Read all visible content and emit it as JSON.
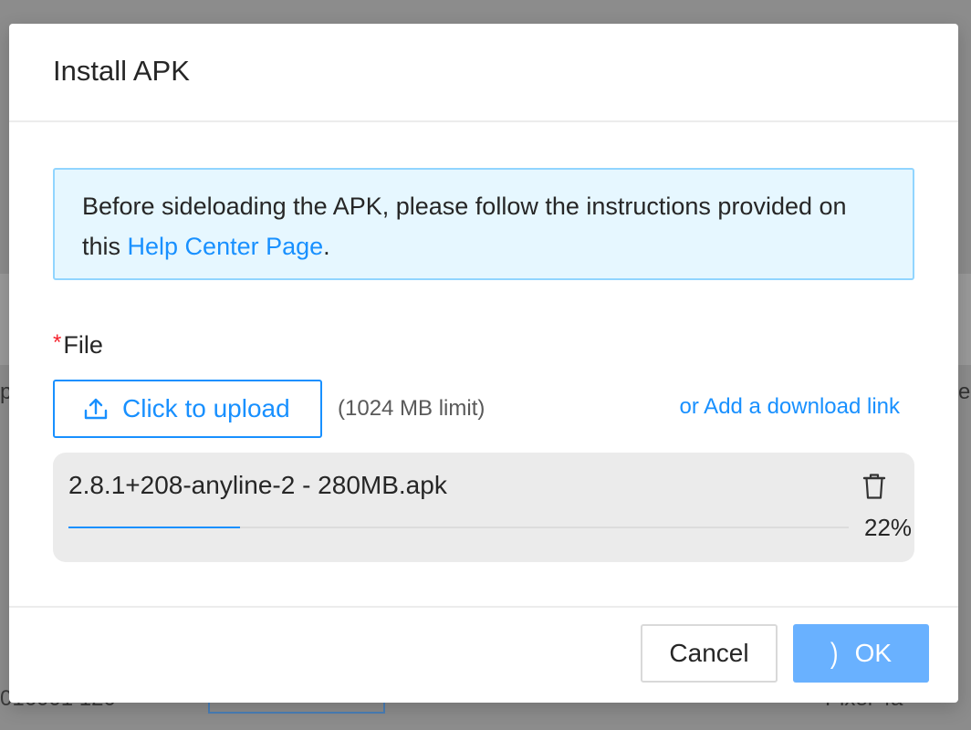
{
  "background": {
    "right_edge_text": "er",
    "left_edge_text": "p",
    "bottom_left_text": "016001 120",
    "bottom_right_text": "Pixel 4a"
  },
  "dialog": {
    "title": "Install APK",
    "alert": {
      "text_before": "Before sideloading the APK, please follow the instructions provided on this ",
      "link_text": "Help Center Page",
      "text_after": "."
    },
    "file_field": {
      "required_mark": "*",
      "label": "File",
      "upload_button_label": "Click to upload",
      "upload_icon": "upload-icon",
      "limit_text": "(1024 MB limit)",
      "download_link": "or Add a download link"
    },
    "uploaded_file": {
      "name": "2.8.1+208-anyline-2 - 280MB.apk",
      "progress_percent": 22,
      "progress_label": "22%",
      "delete_icon": "trash-icon"
    },
    "footer": {
      "cancel_label": "Cancel",
      "ok_label": "OK",
      "ok_loading": true
    }
  },
  "colors": {
    "accent": "#1890ff",
    "alert_bg": "#e6f7ff",
    "alert_border": "#91d5ff",
    "required": "#f5222d",
    "ok_disabled": "#69b1ff"
  }
}
